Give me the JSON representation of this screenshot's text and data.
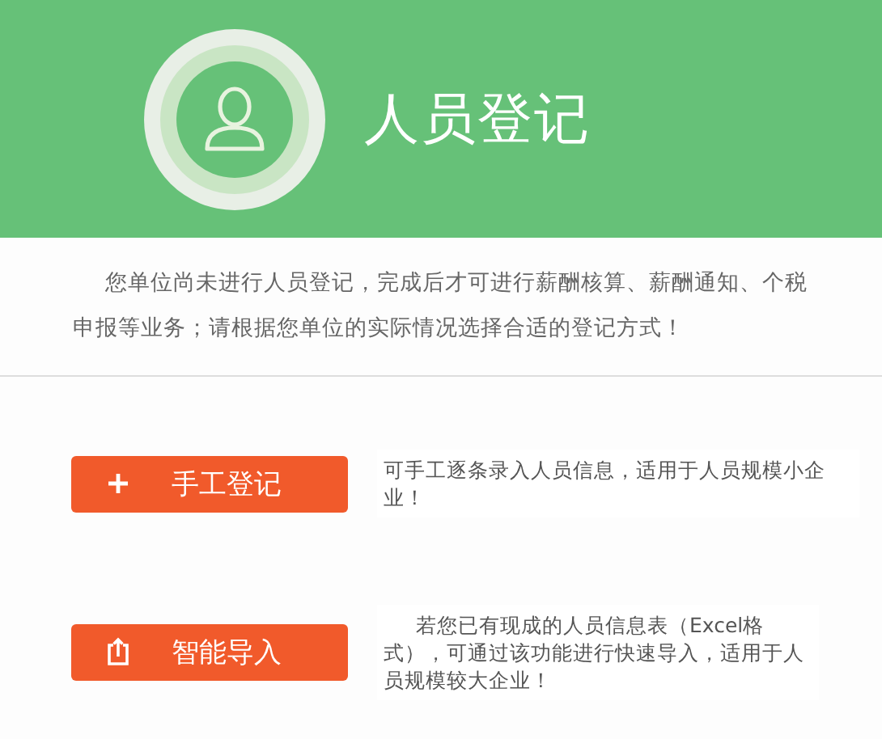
{
  "header": {
    "title": "人员登记"
  },
  "notice": "您单位尚未进行人员登记，完成后才可进行薪酬核算、薪酬通知、个税申报等业务；请根据您单位的实际情况选择合适的登记方式！",
  "options": [
    {
      "kind": "add",
      "label": "手工登记",
      "description": "可手工逐条录入人员信息，适用于人员规模小企业！"
    },
    {
      "kind": "import",
      "label": "智能导入",
      "description": "若您已有现成的人员信息表（Excel格式），可通过该功能进行快速导入，适用于人员规模较大企业！"
    }
  ]
}
